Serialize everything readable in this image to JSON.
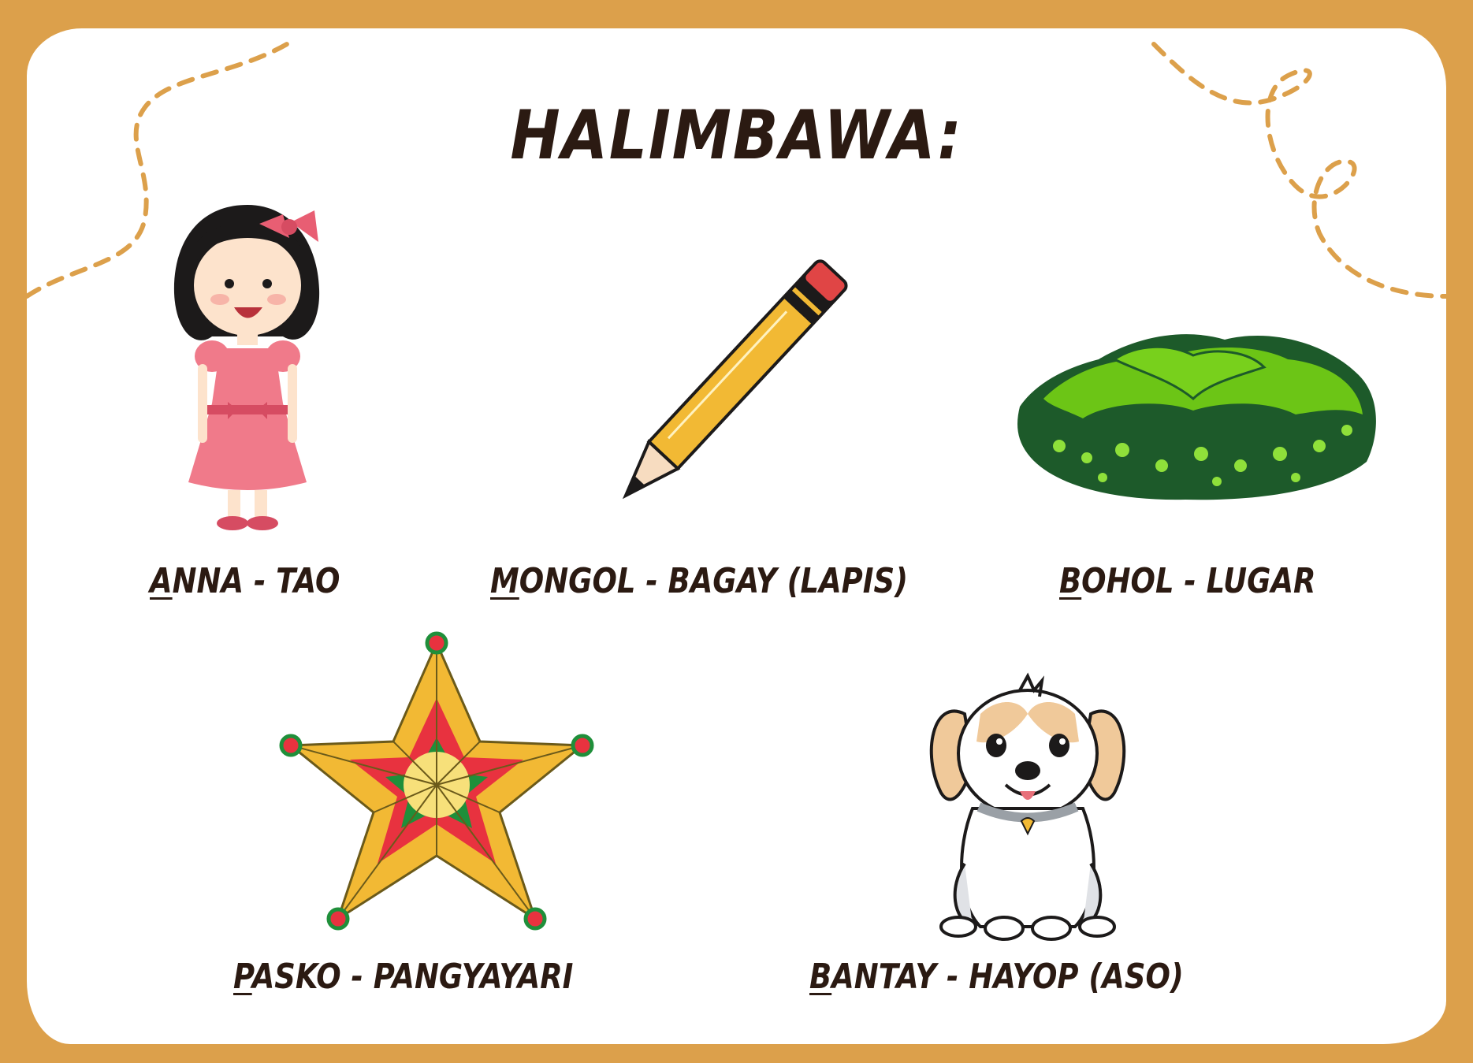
{
  "title": "HALIMBAWA:",
  "examples": [
    {
      "first": "A",
      "rest": "NNA - TAO",
      "icon": "girl-illustration"
    },
    {
      "first": "M",
      "rest": "ONGOL - BAGAY (LAPIS)",
      "icon": "pencil-illustration"
    },
    {
      "first": "B",
      "rest": "OHOL - LUGAR",
      "icon": "chocolate-hills-illustration"
    },
    {
      "first": "P",
      "rest": "ASKO - PANGYAYARI",
      "icon": "parol-star-illustration"
    },
    {
      "first": "B",
      "rest": "ANTAY - HAYOP (ASO)",
      "icon": "puppy-illustration"
    }
  ],
  "colors": {
    "frame": "#dca04b",
    "background": "#ffffff",
    "text": "#2b1a12",
    "dashed_trail": "#dca04b"
  }
}
